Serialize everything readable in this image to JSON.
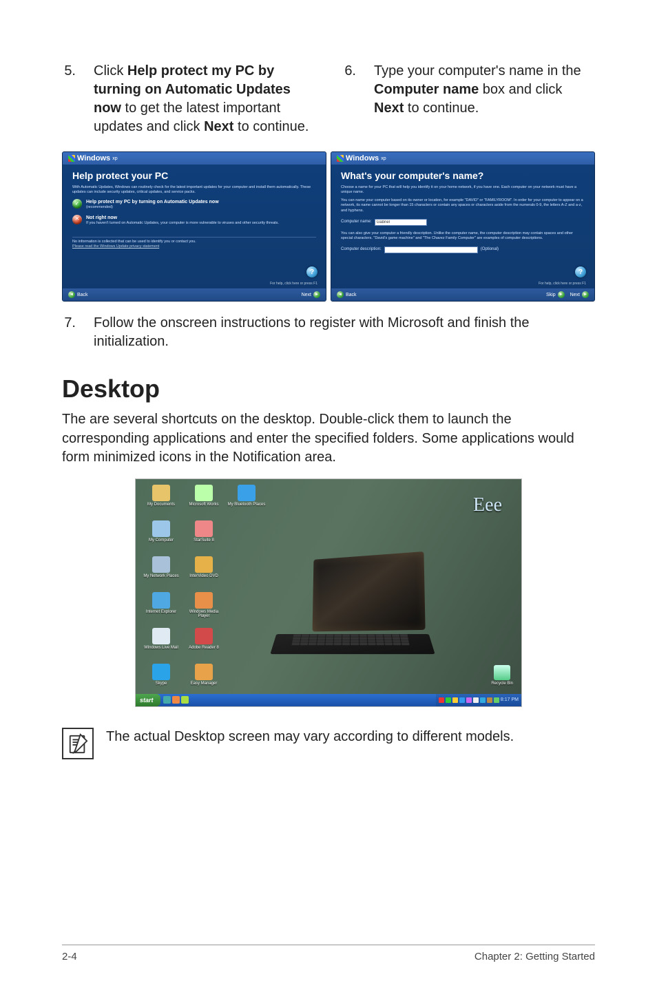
{
  "steps": {
    "s5": {
      "num": "5.",
      "before": "Click ",
      "bold": "Help protect my PC by turning on Automatic Updates now",
      "mid": " to get the latest important updates and click ",
      "bold2": "Next",
      "after": " to continue."
    },
    "s6": {
      "num": "6.",
      "before": "Type your computer's name in the ",
      "bold": "Computer name",
      "mid": " box and click ",
      "bold2": "Next",
      "after": " to continue."
    },
    "s7": {
      "num": "7.",
      "text": "Follow the onscreen instructions to register with Microsoft and finish the initialization."
    }
  },
  "win_left": {
    "brand": "Windows",
    "heading": "Help protect your PC",
    "intro": "With Automatic Updates, Windows can routinely check for the latest important updates for your computer and install them automatically. These updates can include security updates, critical updates, and service packs.",
    "opt1": "Help protect my PC by turning on Automatic Updates now",
    "opt1_sub": "(recommended)",
    "opt2": "Not right now",
    "opt2_sub": "If you haven't turned on Automatic Updates, your computer is more vulnerable to viruses and other security threats.",
    "stmt1": "No information is collected that can be used to identify you or contact you.",
    "stmt2": "Please read the Windows Update privacy statement",
    "help_sub": "For help, click here or press F1",
    "back": "Back",
    "next": "Next"
  },
  "win_right": {
    "brand": "Windows",
    "heading": "What's your computer's name?",
    "intro": "Choose a name for your PC that will help you identify it on your home network, if you have one. Each computer on your network must have a unique name.",
    "para2": "You can name your computer based on its owner or location, for example \"DAVID\" or \"FAMILYROOM\". In order for your computer to appear on a network, its name cannot be longer than 15 characters or contain any spaces or characters aside from the numerals 0-9, the letters A-Z and a-z, and hyphens.",
    "name_label": "Computer name:",
    "name_value": "Gabriel",
    "para3": "You can also give your computer a friendly description. Unlike the computer name, the computer description may contain spaces and other special characters. \"David's game machine\" and \"The Chavez Family Computer\" are examples of computer descriptions.",
    "desc_label": "Computer description:",
    "desc_opt": "(Optional)",
    "help_sub": "For help, click here or press F1",
    "back": "Back",
    "skip": "Skip",
    "next": "Next"
  },
  "section": {
    "title": "Desktop",
    "para": "The are several shortcuts on the desktop. Double-click them to launch the corresponding applications and enter the specified folders. Some applications would form minimized icons in the Notification area."
  },
  "desktop": {
    "eee": "Eee",
    "start": "start",
    "clock": "8:17 PM",
    "recycle": "Recycle Bin",
    "icons": [
      {
        "label": "My Documents",
        "color": "#e7c46a"
      },
      {
        "label": "Microsoft Works",
        "color": "#bfa"
      },
      {
        "label": "My Bluetooth Places",
        "color": "#3aa0e8"
      },
      {
        "label": "My Computer",
        "color": "#9cc7e8"
      },
      {
        "label": "StarSuite 8",
        "color": "#e88"
      },
      {
        "label": "",
        "color": "transparent"
      },
      {
        "label": "My Network Places",
        "color": "#a9c2d9"
      },
      {
        "label": "InterVideo DVD",
        "color": "#e7b14a"
      },
      {
        "label": "",
        "color": "transparent"
      },
      {
        "label": "Internet Explorer",
        "color": "#4fa8e2"
      },
      {
        "label": "Windows Media Player",
        "color": "#e8904a"
      },
      {
        "label": "",
        "color": "transparent"
      },
      {
        "label": "Windows Live Mail",
        "color": "#dfeaf3"
      },
      {
        "label": "Adobe Reader 8",
        "color": "#d24a4a"
      },
      {
        "label": "",
        "color": "transparent"
      },
      {
        "label": "Skype",
        "color": "#2aa3e8"
      },
      {
        "label": "Easy Manager",
        "color": "#e8a24a"
      },
      {
        "label": "",
        "color": "transparent"
      }
    ]
  },
  "note": {
    "text": "The actual Desktop screen may vary according to different models."
  },
  "footer": {
    "left": "2-4",
    "right": "Chapter 2: Getting Started"
  }
}
